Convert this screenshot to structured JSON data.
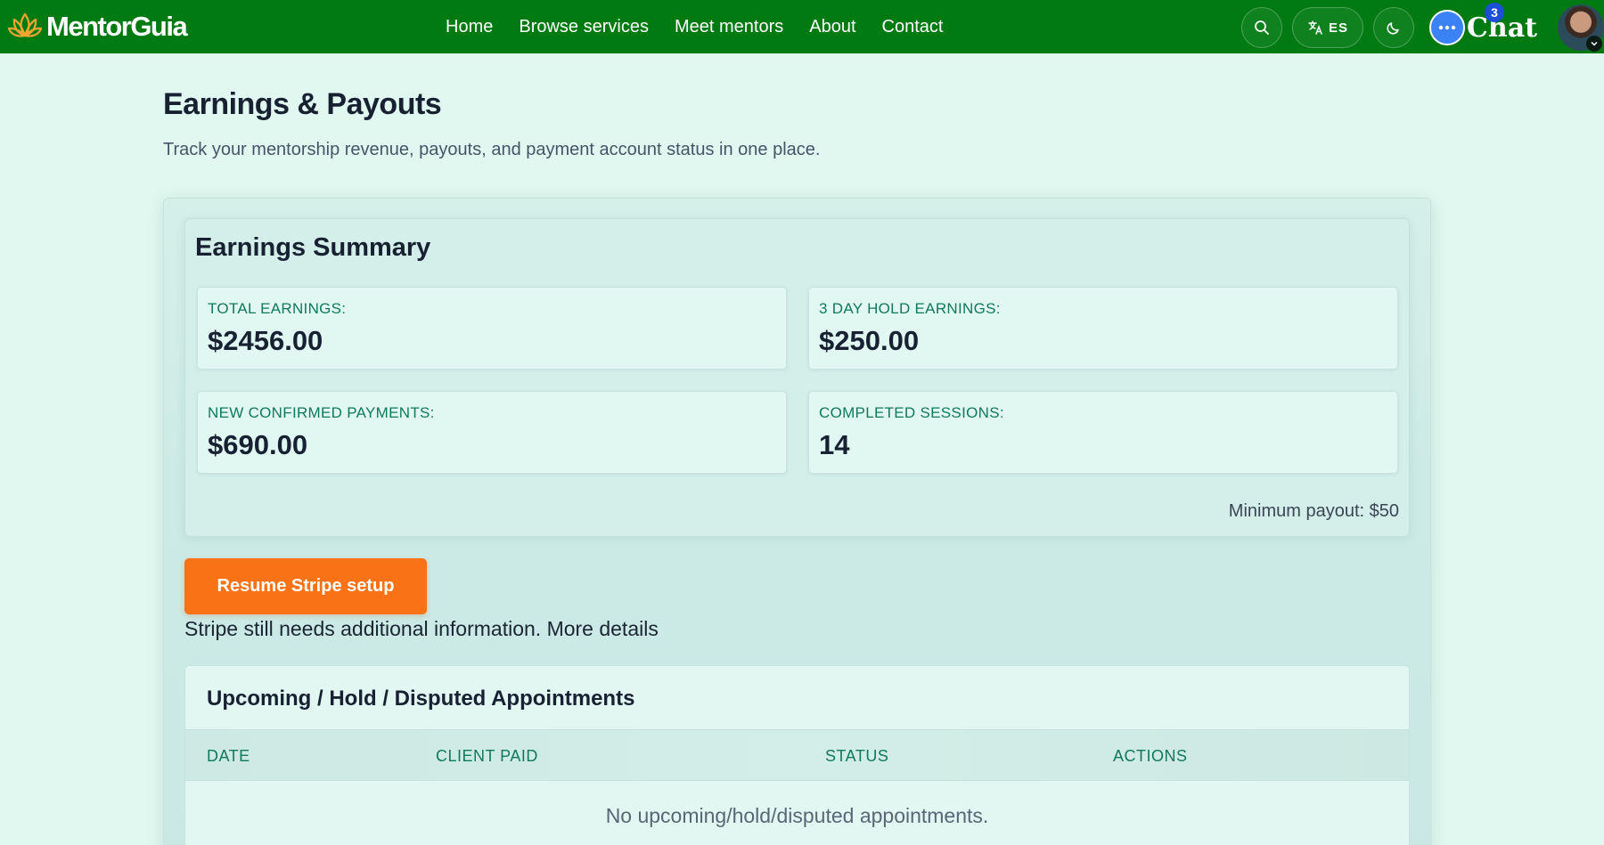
{
  "nav": {
    "brand": "MentorGuia",
    "links": [
      "Home",
      "Browse services",
      "Meet mentors",
      "About",
      "Contact"
    ],
    "lang": "ES",
    "chat_label": "Chat",
    "chat_badge": "3",
    "icons": {
      "search": "search-icon",
      "translate": "translate-icon",
      "theme": "moon-icon",
      "chat": "chat-bubble-icon"
    },
    "colors": {
      "bar": "#017a12",
      "chat": "#3b82f6",
      "badge": "#1d4ed8"
    }
  },
  "page": {
    "title": "Earnings & Payouts",
    "subtitle": "Track your mentorship revenue, payouts, and payment account status in one place."
  },
  "summary": {
    "title": "Earnings Summary",
    "stats": [
      {
        "label": "TOTAL EARNINGS:",
        "value": "$2456.00"
      },
      {
        "label": "3 DAY HOLD EARNINGS:",
        "value": "$250.00"
      },
      {
        "label": "NEW CONFIRMED PAYMENTS:",
        "value": "$690.00"
      },
      {
        "label": "COMPLETED SESSIONS:",
        "value": "14"
      }
    ],
    "min_payout": "Minimum payout: $50"
  },
  "stripe": {
    "button_label": "Resume Stripe setup",
    "note": "Stripe still needs additional information.",
    "more_link": "More details",
    "color": "#f97316"
  },
  "appointments": {
    "title": "Upcoming / Hold / Disputed Appointments",
    "columns": [
      "DATE",
      "CLIENT PAID",
      "STATUS",
      "ACTIONS"
    ],
    "empty_text": "No upcoming/hold/disputed appointments."
  }
}
